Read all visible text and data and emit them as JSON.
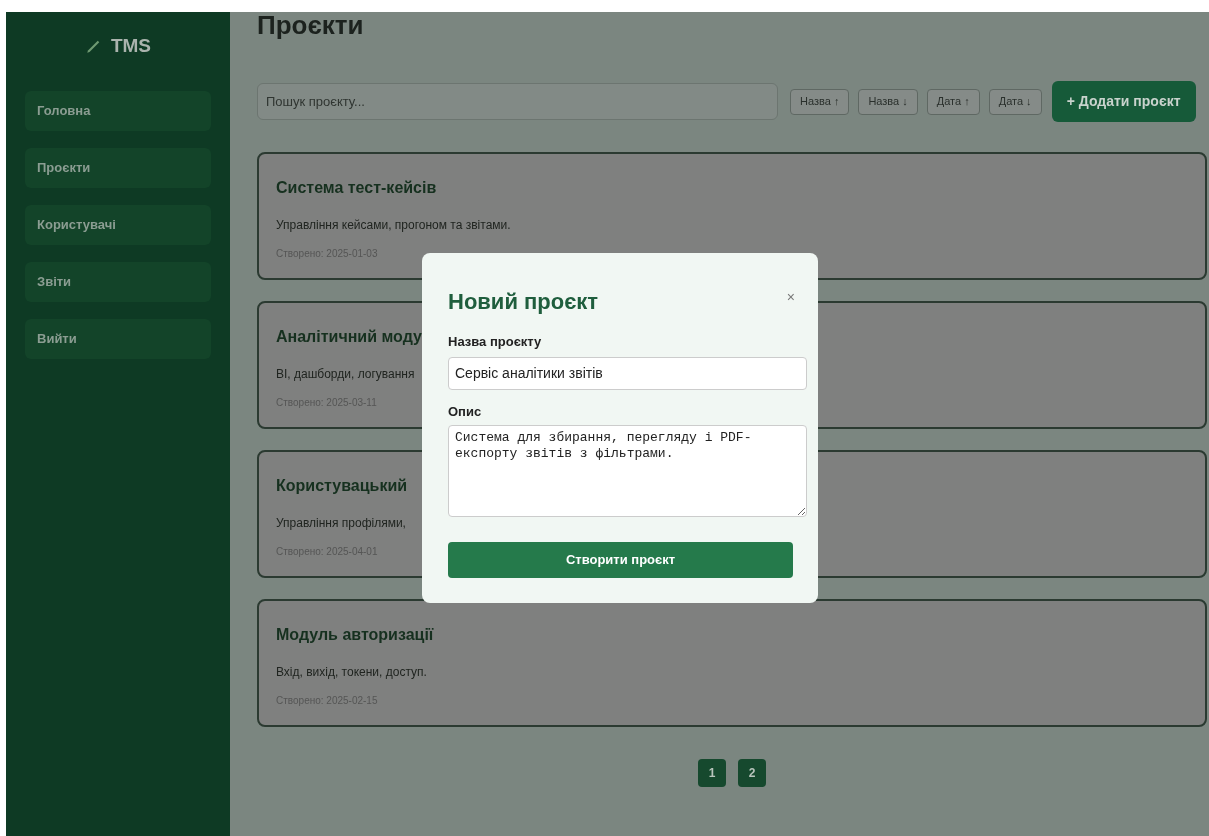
{
  "sidebar": {
    "logo": "TMS",
    "items": [
      {
        "label": "Головна"
      },
      {
        "label": "Проєкти"
      },
      {
        "label": "Користувачі"
      },
      {
        "label": "Звіти"
      },
      {
        "label": "Вийти"
      }
    ]
  },
  "page_title": "Проєкти",
  "search": {
    "placeholder": "Пошук проєкту..."
  },
  "sort_buttons": [
    "Назва ↑",
    "Назва ↓",
    "Дата ↑",
    "Дата ↓"
  ],
  "add_button": "+ Додати проєкт",
  "projects": [
    {
      "title": "Система тест-кейсів",
      "description": "Управління кейсами, прогоном та звітами.",
      "created": "Створено: 2025-01-03"
    },
    {
      "title": "Аналітичний моду",
      "description": "BI, дашборди, логування",
      "created": "Створено: 2025-03-11"
    },
    {
      "title": "Користувацький",
      "description": "Управління профілями,",
      "created": "Створено: 2025-04-01"
    },
    {
      "title": "Модуль авторизації",
      "description": "Вхід, вихід, токени, доступ.",
      "created": "Створено: 2025-02-15"
    }
  ],
  "pagination": [
    "1",
    "2"
  ],
  "modal": {
    "title": "Новий проєкт",
    "close": "×",
    "name_label": "Назва проєкту",
    "name_value": "Сервіс аналітики звітів",
    "description_label": "Опис",
    "description_value": "Система для збирання, перегляду і PDF-експорту звітів з фільтрами.",
    "submit": "Створити проєкт"
  }
}
